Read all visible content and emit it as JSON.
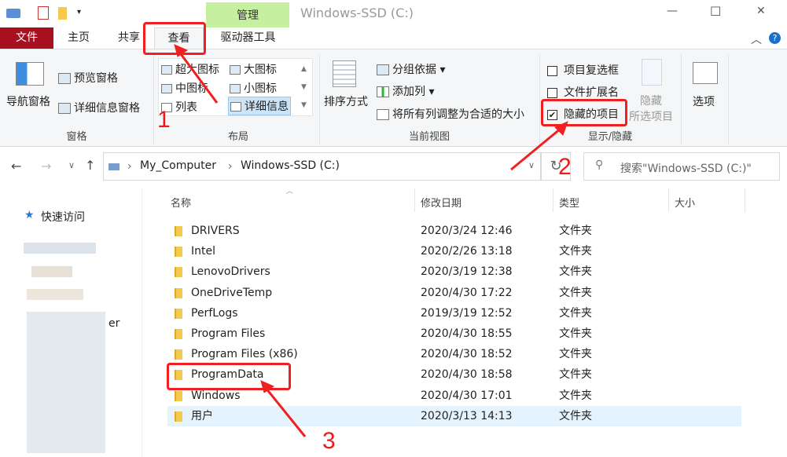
{
  "window": {
    "title": "Windows-SSD (C:)",
    "context_tab": "管理",
    "min": "—",
    "max": "☐",
    "close": "✕"
  },
  "tabs": [
    "文件",
    "主页",
    "共享",
    "查看",
    "驱动器工具"
  ],
  "ribbon": {
    "pane": {
      "nav": "导航窗格",
      "preview": "预览窗格",
      "details": "详细信息窗格",
      "group": "窗格"
    },
    "layout": {
      "items": [
        "超大图标",
        "大图标",
        "中图标",
        "小图标",
        "列表",
        "详细信息"
      ],
      "selected": "详细信息",
      "group": "布局"
    },
    "view": {
      "sort": "排序方式",
      "groupby": "分组依据",
      "addcol": "添加列",
      "fit": "将所有列调整为合适的大小",
      "group": "当前视图"
    },
    "showhide": {
      "checkboxes": {
        "label": "项目复选框",
        "checked": false
      },
      "ext": {
        "label": "文件扩展名",
        "checked": false
      },
      "hidden": {
        "label": "隐藏的项目",
        "checked": true
      },
      "hide_sel1": "隐藏",
      "hide_sel2": "所选项目",
      "group": "显示/隐藏"
    },
    "options": "选项"
  },
  "address": {
    "path": [
      "My_Computer",
      "Windows-SSD (C:)"
    ],
    "search_placeholder": "搜索\"Windows-SSD (C:)\""
  },
  "sidebar": {
    "quick_access": "快速访问",
    "partial": "er"
  },
  "columns": [
    "名称",
    "修改日期",
    "类型",
    "大小"
  ],
  "files": [
    {
      "name": "DRIVERS",
      "date": "2020/3/24 12:46",
      "type": "文件夹"
    },
    {
      "name": "Intel",
      "date": "2020/2/26 13:18",
      "type": "文件夹"
    },
    {
      "name": "LenovoDrivers",
      "date": "2020/3/19 12:38",
      "type": "文件夹"
    },
    {
      "name": "OneDriveTemp",
      "date": "2020/4/30 17:22",
      "type": "文件夹"
    },
    {
      "name": "PerfLogs",
      "date": "2019/3/19 12:52",
      "type": "文件夹"
    },
    {
      "name": "Program Files",
      "date": "2020/4/30 18:55",
      "type": "文件夹"
    },
    {
      "name": "Program Files (x86)",
      "date": "2020/4/30 18:52",
      "type": "文件夹"
    },
    {
      "name": "ProgramData",
      "date": "2020/4/30 18:58",
      "type": "文件夹"
    },
    {
      "name": "Windows",
      "date": "2020/4/30 17:01",
      "type": "文件夹"
    },
    {
      "name": "用户",
      "date": "2020/3/13 14:13",
      "type": "文件夹",
      "selected": true
    }
  ],
  "annotations": [
    "1",
    "2",
    "3"
  ],
  "colors": {
    "file_tab": "#a80f1f",
    "context_tab": "#c6efa0",
    "annotation": "#f02020",
    "selected_row": "#e5f3ff"
  }
}
